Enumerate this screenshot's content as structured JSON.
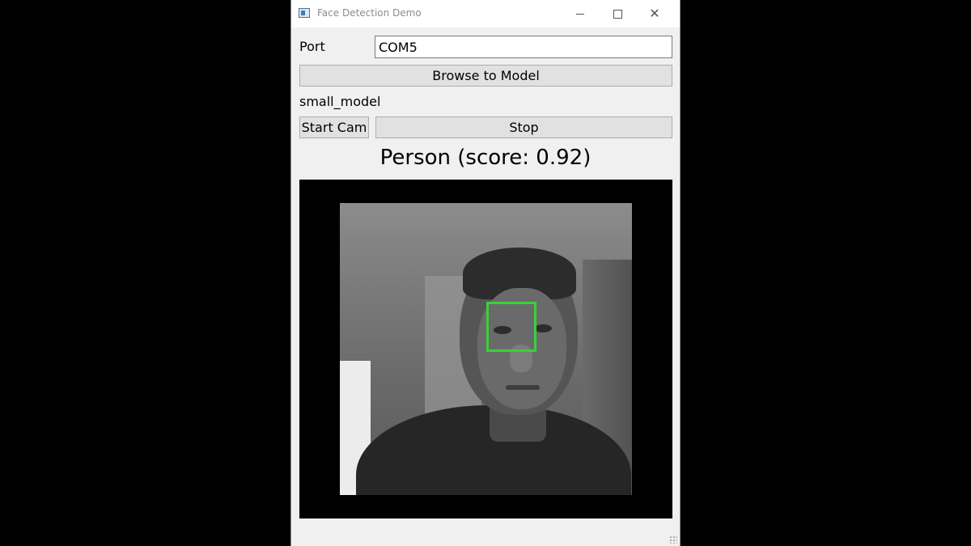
{
  "window": {
    "title": "Face Detection Demo"
  },
  "form": {
    "port_label": "Port",
    "port_value": "COM5",
    "browse_label": "Browse to Model",
    "model_name": "small_model",
    "start_label": "Start Cam",
    "stop_label": "Stop"
  },
  "detection": {
    "text": "Person (score: 0.92)",
    "box_color": "#39d13a"
  },
  "icons": {
    "app": "app-icon",
    "minimize": "minimize-icon",
    "maximize": "maximize-icon",
    "close": "close-icon"
  }
}
